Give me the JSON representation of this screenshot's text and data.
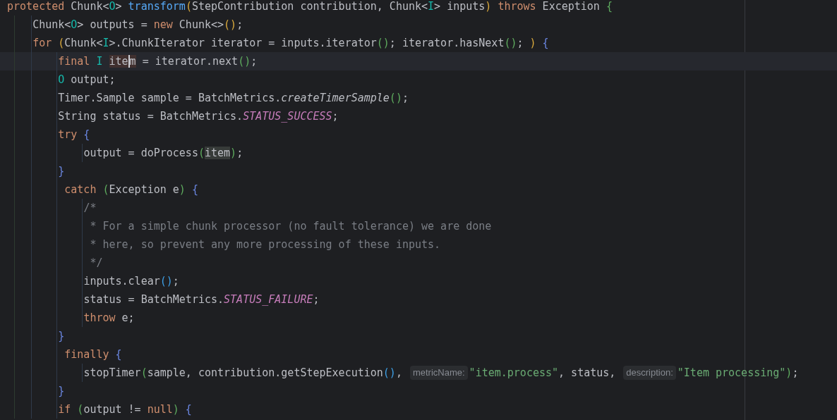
{
  "editor": {
    "lines": [
      {
        "current": false,
        "tokens": [
          {
            "text": "protected",
            "kind": "keyword"
          },
          {
            "text": " Chunk<",
            "kind": "plain"
          },
          {
            "text": "O",
            "kind": "type-param"
          },
          {
            "text": "> ",
            "kind": "plain"
          },
          {
            "text": "transform",
            "kind": "declaration"
          },
          {
            "text": "(",
            "kind": "bracket-yellow"
          },
          {
            "text": "StepContribution contribution, Chunk<",
            "kind": "plain"
          },
          {
            "text": "I",
            "kind": "type-param"
          },
          {
            "text": "> inputs",
            "kind": "plain"
          },
          {
            "text": ")",
            "kind": "bracket-yellow"
          },
          {
            "text": " throws",
            "kind": "keyword"
          },
          {
            "text": " Exception ",
            "kind": "plain"
          },
          {
            "text": "{",
            "kind": "bracket-green"
          }
        ]
      },
      {
        "current": false,
        "tokens": [
          {
            "text": "    Chunk<",
            "kind": "plain"
          },
          {
            "text": "O",
            "kind": "type-param"
          },
          {
            "text": "> outputs = ",
            "kind": "plain"
          },
          {
            "text": "new",
            "kind": "keyword"
          },
          {
            "text": " Chunk<>",
            "kind": "plain"
          },
          {
            "text": "()",
            "kind": "bracket-yellow"
          },
          {
            "text": ";",
            "kind": "plain"
          }
        ]
      },
      {
        "current": false,
        "tokens": [
          {
            "text": "    for",
            "kind": "keyword"
          },
          {
            "text": " (",
            "kind": "bracket-yellow"
          },
          {
            "text": "Chunk<",
            "kind": "plain"
          },
          {
            "text": "I",
            "kind": "type-param"
          },
          {
            "text": ">.ChunkIterator iterator = inputs.iterator",
            "kind": "plain"
          },
          {
            "text": "()",
            "kind": "bracket-green"
          },
          {
            "text": "; iterator.hasNext",
            "kind": "plain"
          },
          {
            "text": "()",
            "kind": "bracket-green"
          },
          {
            "text": "; ",
            "kind": "plain"
          },
          {
            "text": ")",
            "kind": "bracket-yellow"
          },
          {
            "text": " {",
            "kind": "bracket-violet"
          }
        ]
      },
      {
        "current": true,
        "tokens": [
          {
            "text": "        final",
            "kind": "keyword"
          },
          {
            "text": " I ",
            "kind": "type-param"
          },
          {
            "text": "ite",
            "kind": "write-usage"
          },
          {
            "text": "m",
            "kind": "write-usage",
            "caret": true
          },
          {
            "text": " = iterator.next",
            "kind": "plain"
          },
          {
            "text": "()",
            "kind": "bracket-green"
          },
          {
            "text": ";",
            "kind": "plain"
          }
        ]
      },
      {
        "current": false,
        "tokens": [
          {
            "text": "        O",
            "kind": "type-param"
          },
          {
            "text": " output;",
            "kind": "plain"
          }
        ]
      },
      {
        "current": false,
        "tokens": [
          {
            "text": "        Timer.Sample sample = BatchMetrics.",
            "kind": "plain"
          },
          {
            "text": "createTimerSample",
            "kind": "static-call"
          },
          {
            "text": "()",
            "kind": "bracket-green"
          },
          {
            "text": ";",
            "kind": "plain"
          }
        ]
      },
      {
        "current": false,
        "tokens": [
          {
            "text": "        String status = BatchMetrics.",
            "kind": "plain"
          },
          {
            "text": "STATUS_SUCCESS",
            "kind": "constant"
          },
          {
            "text": ";",
            "kind": "plain"
          }
        ]
      },
      {
        "current": false,
        "tokens": [
          {
            "text": "        try",
            "kind": "keyword"
          },
          {
            "text": " {",
            "kind": "bracket-violet"
          }
        ]
      },
      {
        "current": false,
        "tokens": [
          {
            "text": "            output = doProcess",
            "kind": "plain"
          },
          {
            "text": "(",
            "kind": "bracket-green"
          },
          {
            "text": "item",
            "kind": "read-usage"
          },
          {
            "text": ")",
            "kind": "bracket-green"
          },
          {
            "text": ";",
            "kind": "plain"
          }
        ]
      },
      {
        "current": false,
        "tokens": [
          {
            "text": "        }",
            "kind": "bracket-violet"
          }
        ]
      },
      {
        "current": false,
        "tokens": [
          {
            "text": "         catch",
            "kind": "keyword"
          },
          {
            "text": " (",
            "kind": "bracket-green"
          },
          {
            "text": "Exception e",
            "kind": "plain"
          },
          {
            "text": ")",
            "kind": "bracket-green"
          },
          {
            "text": " {",
            "kind": "bracket-violet"
          }
        ]
      },
      {
        "current": false,
        "tokens": [
          {
            "text": "            /*",
            "kind": "comment"
          }
        ]
      },
      {
        "current": false,
        "tokens": [
          {
            "text": "             * For a simple chunk processor (no fault tolerance) we are done",
            "kind": "comment"
          }
        ]
      },
      {
        "current": false,
        "tokens": [
          {
            "text": "             * here, so prevent any more processing of these inputs.",
            "kind": "comment"
          }
        ]
      },
      {
        "current": false,
        "tokens": [
          {
            "text": "             */",
            "kind": "comment"
          }
        ]
      },
      {
        "current": false,
        "tokens": [
          {
            "text": "            inputs.clear",
            "kind": "plain"
          },
          {
            "text": "()",
            "kind": "bracket-blue"
          },
          {
            "text": ";",
            "kind": "plain"
          }
        ]
      },
      {
        "current": false,
        "tokens": [
          {
            "text": "            status = BatchMetrics.",
            "kind": "plain"
          },
          {
            "text": "STATUS_FAILURE",
            "kind": "constant"
          },
          {
            "text": ";",
            "kind": "plain"
          }
        ]
      },
      {
        "current": false,
        "tokens": [
          {
            "text": "            throw",
            "kind": "keyword"
          },
          {
            "text": " e;",
            "kind": "plain"
          }
        ]
      },
      {
        "current": false,
        "tokens": [
          {
            "text": "        }",
            "kind": "bracket-violet"
          }
        ]
      },
      {
        "current": false,
        "tokens": [
          {
            "text": "         finally",
            "kind": "keyword"
          },
          {
            "text": " {",
            "kind": "bracket-violet"
          }
        ]
      },
      {
        "current": false,
        "tokens": [
          {
            "text": "            stopTimer",
            "kind": "plain"
          },
          {
            "text": "(",
            "kind": "bracket-green"
          },
          {
            "text": "sample, contribution.getStepExecution",
            "kind": "plain"
          },
          {
            "text": "()",
            "kind": "bracket-blue"
          },
          {
            "text": ",",
            "kind": "plain"
          },
          {
            "text": "metricName:",
            "kind": "hint"
          },
          {
            "text": "\"item.process\"",
            "kind": "string"
          },
          {
            "text": ", status,",
            "kind": "plain"
          },
          {
            "text": "description:",
            "kind": "hint"
          },
          {
            "text": "\"Item processing\"",
            "kind": "string"
          },
          {
            "text": ")",
            "kind": "bracket-green"
          },
          {
            "text": ";",
            "kind": "plain"
          }
        ]
      },
      {
        "current": false,
        "tokens": [
          {
            "text": "        }",
            "kind": "bracket-violet"
          }
        ]
      },
      {
        "current": false,
        "tokens": [
          {
            "text": "        if",
            "kind": "keyword"
          },
          {
            "text": " (",
            "kind": "bracket-green"
          },
          {
            "text": "output != ",
            "kind": "plain"
          },
          {
            "text": "null",
            "kind": "keyword"
          },
          {
            "text": ")",
            "kind": "bracket-green"
          },
          {
            "text": " {",
            "kind": "bracket-violet"
          }
        ]
      }
    ]
  }
}
